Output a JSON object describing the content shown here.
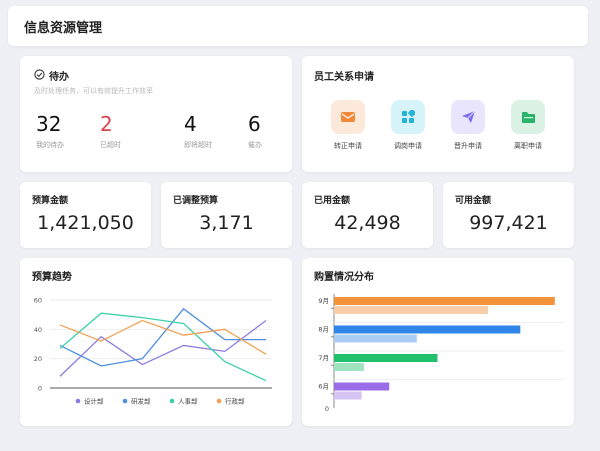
{
  "page_title": "信息资源管理",
  "todo": {
    "title": "待办",
    "subtitle": "及时处理任务，可以有效提升工作效率",
    "stats": [
      {
        "value": "32",
        "label": "我的待办"
      },
      {
        "value": "2",
        "label": "已超时"
      },
      {
        "value": "4",
        "label": "即将超时"
      },
      {
        "value": "6",
        "label": "催办"
      }
    ]
  },
  "apps": {
    "title": "员工关系申请",
    "items": [
      {
        "label": "转正申请",
        "icon": "mail-icon",
        "color": "#f08a3a",
        "bg": "#fde9da"
      },
      {
        "label": "调岗申请",
        "icon": "grid-icon",
        "color": "#22b3d6",
        "bg": "#d6f3f9"
      },
      {
        "label": "晋升申请",
        "icon": "paper-plane-icon",
        "color": "#7a6cf0",
        "bg": "#e8e5fd"
      },
      {
        "label": "离职申请",
        "icon": "folder-icon",
        "color": "#2cb36b",
        "bg": "#daf2e3"
      }
    ]
  },
  "budget": [
    {
      "label": "预算金额",
      "value": "1,421,050"
    },
    {
      "label": "已调整预算",
      "value": "3,171"
    },
    {
      "label": "已用金额",
      "value": "42,498"
    },
    {
      "label": "可用金额",
      "value": "997,421"
    }
  ],
  "trend": {
    "title": "预算趋势"
  },
  "purchase": {
    "title": "购置情况分布"
  },
  "chart_data": [
    {
      "type": "line",
      "title": "预算趋势",
      "x": [
        1,
        2,
        3,
        4,
        5,
        6
      ],
      "ylim": [
        0,
        60
      ],
      "yticks": [
        0,
        20,
        40,
        60
      ],
      "grid": true,
      "legend": "bottom",
      "series": [
        {
          "name": "设计部",
          "color": "#8e7ae0",
          "values": [
            8,
            35,
            16,
            29,
            25,
            46
          ]
        },
        {
          "name": "研发部",
          "color": "#4e8fe0",
          "values": [
            29,
            15,
            20,
            54,
            33,
            33
          ]
        },
        {
          "name": "人事部",
          "color": "#3ed1a8",
          "values": [
            27,
            51,
            48,
            44,
            18,
            5
          ]
        },
        {
          "name": "行政部",
          "color": "#f0a052",
          "values": [
            43,
            32,
            46,
            36,
            40,
            23
          ]
        }
      ]
    },
    {
      "type": "bar",
      "orientation": "horizontal",
      "title": "购置情况分布",
      "categories": [
        "9月",
        "8月",
        "7月",
        "6月"
      ],
      "x_zero_label": "0",
      "xlim": [
        0,
        100
      ],
      "series": [
        {
          "values": [
            96,
            81,
            45,
            24
          ],
          "colors": [
            "#f2923a",
            "#2f86e8",
            "#22c06a",
            "#9b6ce8"
          ]
        },
        {
          "values": [
            67,
            36,
            13,
            12
          ],
          "colors": [
            "#f8ceaa",
            "#a9ccf5",
            "#9fe3c0",
            "#d6c4f5"
          ]
        }
      ]
    }
  ]
}
